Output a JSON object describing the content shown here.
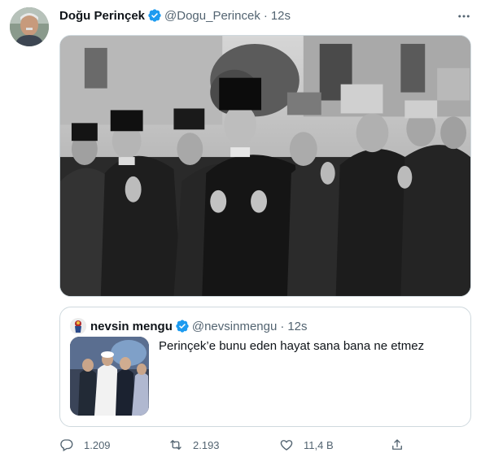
{
  "tweet": {
    "author_name": "Doğu Perinçek",
    "author_handle": "@Dogu_Perincek",
    "separator": "·",
    "time": "12s",
    "avatar_icon": "author-avatar",
    "verified_icon": "verified-badge-icon",
    "more_icon": "more-options-icon"
  },
  "quote": {
    "author_name": "nevsin mengu",
    "author_handle": "@nevsinmengu",
    "separator": "·",
    "time": "12s",
    "text": "Perinçek’e bunu eden hayat sana bana ne etmez"
  },
  "actions": {
    "reply_count": "1.209",
    "retweet_count": "2.193",
    "like_count": "11,4 B",
    "reply_icon": "reply-icon",
    "retweet_icon": "retweet-icon",
    "like_icon": "heart-icon",
    "share_icon": "share-icon"
  },
  "colors": {
    "verified": "#1d9bf0",
    "secondary_text": "#536471",
    "border": "#cfd9de"
  }
}
